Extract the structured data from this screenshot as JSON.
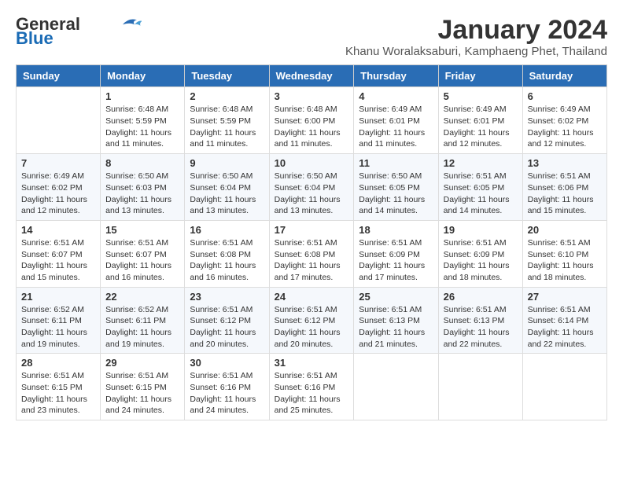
{
  "logo": {
    "general": "General",
    "blue": "Blue"
  },
  "title": "January 2024",
  "location": "Khanu Woralaksaburi, Kamphaeng Phet, Thailand",
  "weekdays": [
    "Sunday",
    "Monday",
    "Tuesday",
    "Wednesday",
    "Thursday",
    "Friday",
    "Saturday"
  ],
  "weeks": [
    [
      {
        "day": "",
        "content": ""
      },
      {
        "day": "1",
        "content": "Sunrise: 6:48 AM\nSunset: 5:59 PM\nDaylight: 11 hours\nand 11 minutes."
      },
      {
        "day": "2",
        "content": "Sunrise: 6:48 AM\nSunset: 5:59 PM\nDaylight: 11 hours\nand 11 minutes."
      },
      {
        "day": "3",
        "content": "Sunrise: 6:48 AM\nSunset: 6:00 PM\nDaylight: 11 hours\nand 11 minutes."
      },
      {
        "day": "4",
        "content": "Sunrise: 6:49 AM\nSunset: 6:01 PM\nDaylight: 11 hours\nand 11 minutes."
      },
      {
        "day": "5",
        "content": "Sunrise: 6:49 AM\nSunset: 6:01 PM\nDaylight: 11 hours\nand 12 minutes."
      },
      {
        "day": "6",
        "content": "Sunrise: 6:49 AM\nSunset: 6:02 PM\nDaylight: 11 hours\nand 12 minutes."
      }
    ],
    [
      {
        "day": "7",
        "content": "Sunrise: 6:49 AM\nSunset: 6:02 PM\nDaylight: 11 hours\nand 12 minutes."
      },
      {
        "day": "8",
        "content": "Sunrise: 6:50 AM\nSunset: 6:03 PM\nDaylight: 11 hours\nand 13 minutes."
      },
      {
        "day": "9",
        "content": "Sunrise: 6:50 AM\nSunset: 6:04 PM\nDaylight: 11 hours\nand 13 minutes."
      },
      {
        "day": "10",
        "content": "Sunrise: 6:50 AM\nSunset: 6:04 PM\nDaylight: 11 hours\nand 13 minutes."
      },
      {
        "day": "11",
        "content": "Sunrise: 6:50 AM\nSunset: 6:05 PM\nDaylight: 11 hours\nand 14 minutes."
      },
      {
        "day": "12",
        "content": "Sunrise: 6:51 AM\nSunset: 6:05 PM\nDaylight: 11 hours\nand 14 minutes."
      },
      {
        "day": "13",
        "content": "Sunrise: 6:51 AM\nSunset: 6:06 PM\nDaylight: 11 hours\nand 15 minutes."
      }
    ],
    [
      {
        "day": "14",
        "content": "Sunrise: 6:51 AM\nSunset: 6:07 PM\nDaylight: 11 hours\nand 15 minutes."
      },
      {
        "day": "15",
        "content": "Sunrise: 6:51 AM\nSunset: 6:07 PM\nDaylight: 11 hours\nand 16 minutes."
      },
      {
        "day": "16",
        "content": "Sunrise: 6:51 AM\nSunset: 6:08 PM\nDaylight: 11 hours\nand 16 minutes."
      },
      {
        "day": "17",
        "content": "Sunrise: 6:51 AM\nSunset: 6:08 PM\nDaylight: 11 hours\nand 17 minutes."
      },
      {
        "day": "18",
        "content": "Sunrise: 6:51 AM\nSunset: 6:09 PM\nDaylight: 11 hours\nand 17 minutes."
      },
      {
        "day": "19",
        "content": "Sunrise: 6:51 AM\nSunset: 6:09 PM\nDaylight: 11 hours\nand 18 minutes."
      },
      {
        "day": "20",
        "content": "Sunrise: 6:51 AM\nSunset: 6:10 PM\nDaylight: 11 hours\nand 18 minutes."
      }
    ],
    [
      {
        "day": "21",
        "content": "Sunrise: 6:52 AM\nSunset: 6:11 PM\nDaylight: 11 hours\nand 19 minutes."
      },
      {
        "day": "22",
        "content": "Sunrise: 6:52 AM\nSunset: 6:11 PM\nDaylight: 11 hours\nand 19 minutes."
      },
      {
        "day": "23",
        "content": "Sunrise: 6:51 AM\nSunset: 6:12 PM\nDaylight: 11 hours\nand 20 minutes."
      },
      {
        "day": "24",
        "content": "Sunrise: 6:51 AM\nSunset: 6:12 PM\nDaylight: 11 hours\nand 20 minutes."
      },
      {
        "day": "25",
        "content": "Sunrise: 6:51 AM\nSunset: 6:13 PM\nDaylight: 11 hours\nand 21 minutes."
      },
      {
        "day": "26",
        "content": "Sunrise: 6:51 AM\nSunset: 6:13 PM\nDaylight: 11 hours\nand 22 minutes."
      },
      {
        "day": "27",
        "content": "Sunrise: 6:51 AM\nSunset: 6:14 PM\nDaylight: 11 hours\nand 22 minutes."
      }
    ],
    [
      {
        "day": "28",
        "content": "Sunrise: 6:51 AM\nSunset: 6:15 PM\nDaylight: 11 hours\nand 23 minutes."
      },
      {
        "day": "29",
        "content": "Sunrise: 6:51 AM\nSunset: 6:15 PM\nDaylight: 11 hours\nand 24 minutes."
      },
      {
        "day": "30",
        "content": "Sunrise: 6:51 AM\nSunset: 6:16 PM\nDaylight: 11 hours\nand 24 minutes."
      },
      {
        "day": "31",
        "content": "Sunrise: 6:51 AM\nSunset: 6:16 PM\nDaylight: 11 hours\nand 25 minutes."
      },
      {
        "day": "",
        "content": ""
      },
      {
        "day": "",
        "content": ""
      },
      {
        "day": "",
        "content": ""
      }
    ]
  ]
}
